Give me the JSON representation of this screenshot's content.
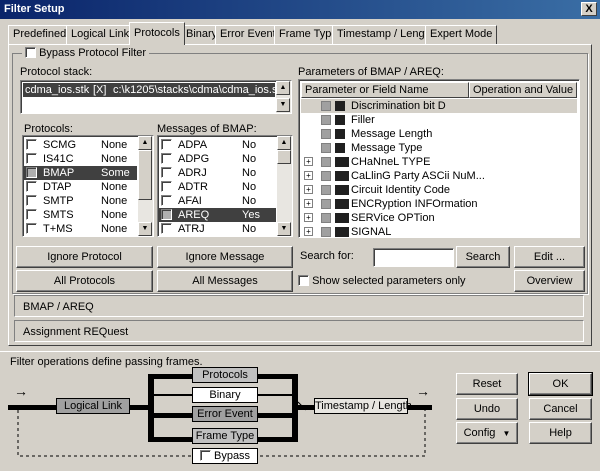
{
  "window": {
    "title": "Filter Setup",
    "close_glyph": "X"
  },
  "tabs": [
    "Predefined",
    "Logical Links",
    "Protocols",
    "Binary",
    "Error Event",
    "Frame Type",
    "Timestamp / Length",
    "Expert Mode"
  ],
  "bypass_protocol_filter": "Bypass Protocol Filter",
  "protocol_stack": {
    "label": "Protocol stack:",
    "name": "cdma_ios.stk",
    "flag": "[X]",
    "path": "c:\\k1205\\stacks\\cdma\\cdma_ios.stk"
  },
  "protocols": {
    "label": "Protocols:",
    "items": [
      {
        "name": "SCMG",
        "value": "None"
      },
      {
        "name": "IS41C",
        "value": "None"
      },
      {
        "name": "BMAP",
        "value": "Some"
      },
      {
        "name": "DTAP",
        "value": "None"
      },
      {
        "name": "SMTP",
        "value": "None"
      },
      {
        "name": "SMTS",
        "value": "None"
      },
      {
        "name": "T+MS",
        "value": "None"
      }
    ]
  },
  "messages": {
    "label": "Messages of BMAP:",
    "items": [
      {
        "name": "ADPA",
        "value": "No"
      },
      {
        "name": "ADPG",
        "value": "No"
      },
      {
        "name": "ADRJ",
        "value": "No"
      },
      {
        "name": "ADTR",
        "value": "No"
      },
      {
        "name": "AFAI",
        "value": "No"
      },
      {
        "name": "AREQ",
        "value": "Yes"
      },
      {
        "name": "ATRJ",
        "value": "No"
      }
    ]
  },
  "parameters": {
    "label": "Parameters of BMAP / AREQ:",
    "col_name": "Parameter or Field Name",
    "col_op": "Operation and Value",
    "items": [
      {
        "name": "Discrimination bit D",
        "expandable": false
      },
      {
        "name": "Filler",
        "expandable": false
      },
      {
        "name": "Message Length",
        "expandable": false
      },
      {
        "name": "Message Type",
        "expandable": false
      },
      {
        "name": "CHaNneL TYPE",
        "expandable": true
      },
      {
        "name": "CaLlinG Party ASCii NuM...",
        "expandable": true
      },
      {
        "name": "Circuit Identity Code",
        "expandable": true
      },
      {
        "name": "ENCRyption INFOrmation",
        "expandable": true
      },
      {
        "name": "SERVice OPTion",
        "expandable": true
      },
      {
        "name": "SIGNAL",
        "expandable": true
      }
    ],
    "plus_glyph": "+"
  },
  "buttons": {
    "ignore_protocol": "Ignore Protocol",
    "ignore_message": "Ignore Message",
    "all_protocols": "All Protocols",
    "all_messages": "All Messages",
    "search": "Search",
    "edit": "Edit ...",
    "overview": "Overview",
    "reset": "Reset",
    "ok": "OK",
    "undo": "Undo",
    "cancel": "Cancel",
    "config": "Config",
    "help": "Help"
  },
  "search": {
    "label": "Search for:",
    "value": ""
  },
  "show_selected": "Show selected parameters only",
  "selection": {
    "path": "BMAP / AREQ",
    "description": "Assignment REQuest"
  },
  "flow": {
    "caption": "Filter operations define passing frames.",
    "logical_link": "Logical Link",
    "protocols": "Protocols",
    "binary": "Binary",
    "error_event": "Error Event",
    "frame_type": "Frame Type",
    "timestamp": "Timestamp / Length",
    "bypass": "Bypass",
    "arrow": "→"
  },
  "glyphs": {
    "up": "▲",
    "down": "▼"
  },
  "icons": [
    "close-icon",
    "checkbox-icon",
    "folder-icon",
    "expand-icon",
    "scroll-up-icon",
    "scroll-down-icon",
    "dropdown-arrow-icon",
    "arrow-right-icon"
  ]
}
